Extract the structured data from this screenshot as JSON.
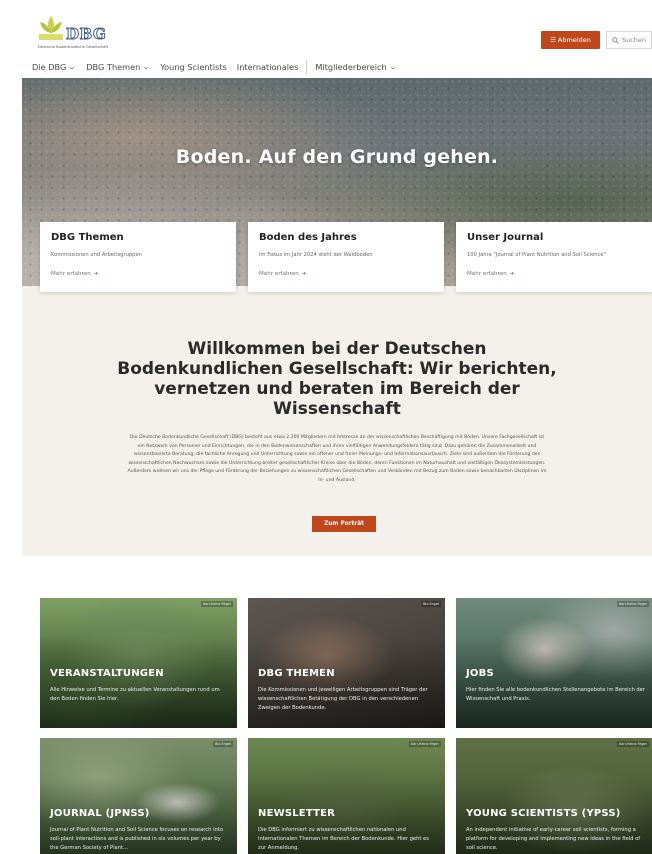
{
  "brand": {
    "logo_text": "DBG",
    "logo_subtitle": "Deutsche Bodenkundliche Gesellschaft",
    "accent": "#c0471c"
  },
  "header": {
    "logout_label": "Abmelden",
    "search_label": "Suchen"
  },
  "nav": {
    "items": [
      {
        "label": "Die DBG",
        "dropdown": true
      },
      {
        "label": "DBG Themen",
        "dropdown": true
      },
      {
        "label": "Young Scientists",
        "dropdown": false
      },
      {
        "label": "Internationales",
        "dropdown": false
      },
      {
        "label": "Mitgliederbereich",
        "dropdown": true
      }
    ]
  },
  "hero": {
    "title": "Boden. Auf den Grund gehen."
  },
  "feature_cards": [
    {
      "title": "DBG Themen",
      "subtitle": "Kommissionen und Arbeitsgruppen",
      "more": "Mehr erfahren"
    },
    {
      "title": "Boden des Jahres",
      "subtitle": "Im Fokus im Jahr 2024 steht der Waldboden",
      "more": "Mehr erfahren"
    },
    {
      "title": "Unser Journal",
      "subtitle": "100 Jahre \"Journal of Plant Nutrition and Soil Science\"",
      "more": "Mehr erfahren"
    }
  ],
  "welcome": {
    "heading": "Willkommen bei der Deutschen Bodenkundlichen Gesellschaft: Wir berichten, vernetzen und beraten im Bereich der Wissenschaft",
    "body": "Die Deutsche Bodenkundliche Gesellschaft (DBG) besteht aus etwa 2.300 Mitgliedern mit Interesse an der wissenschaftlichen Beschäftigung mit Böden. Unsere Fachgesellschaft ist ein Netzwerk von Personen und Einrichtungen, die in den Bodenwissenschaften und ihren vielfältigen Anwendungsfeldern tätig sind. Dazu gehören die Zusammenarbeit und wissensbasierte Beratung, die fachliche Anregung und Unterrichtung sowie ein offener und freier Meinungs- und Informationsaustausch. Ziele sind außerdem die Förderung des wissenschaftlichen Nachwuchses sowie die Unterrichtung breiter gesellschaftlicher Kreise über die Böden, deren Funktionen im Naturhaushalt und vielfältigen Ökosystemleistungen. Außerdem widmen wir uns der Pflege und Förderung der Beziehungen zu wissenschaftlichen Gesellschaften und Verbänden mit Bezug zum Boden sowie benachbarten Disziplinen im In- und Ausland.",
    "button": "Zum Porträt"
  },
  "tiles": [
    {
      "title": "VERANSTALTUNGEN",
      "credit": "Karl-Heinz Feger",
      "desc": "Alle Hinweise und Termine zu aktuellen Veranstaltungen rund um den Boden finden Sie hier."
    },
    {
      "title": "DBG THEMEN",
      "credit": "Bio Engel",
      "desc": "Die Kommissionen und jeweiligen Arbeitsgruppen sind Träger der wissenschaftlichen Betätigung der DBG in den verschiedenen Zweigen der Bodenkunde."
    },
    {
      "title": "JOBS",
      "credit": "Karl-Heinz Feger",
      "desc": "Hier finden Sie alle bodenkundlichen Stellenangebote im Bereich der Wissenschaft und Praxis."
    },
    {
      "title": "JOURNAL (JPNSS)",
      "credit": "Bio Engel",
      "desc": "Journal of Plant Nutrition and Soil Science focuses on research into soil-plant interactions and is published in six volumes per year by the German Society of Plant..."
    },
    {
      "title": "NEWSLETTER",
      "credit": "Karl-Heinz Feger",
      "desc": "Die DBG informiert zu wissenschaftlichen nationalen und internationalen Themen im Bereich der Bodenkunde. Hier geht es zur Anmeldung."
    },
    {
      "title": "YOUNG SCIENTISTS (YPSS)",
      "credit": "Karl-Heinz Feger",
      "desc": "An independent initiative of early-career soil scientists, forming a platform for developing and implementing new ideas in the field of soil science."
    }
  ]
}
